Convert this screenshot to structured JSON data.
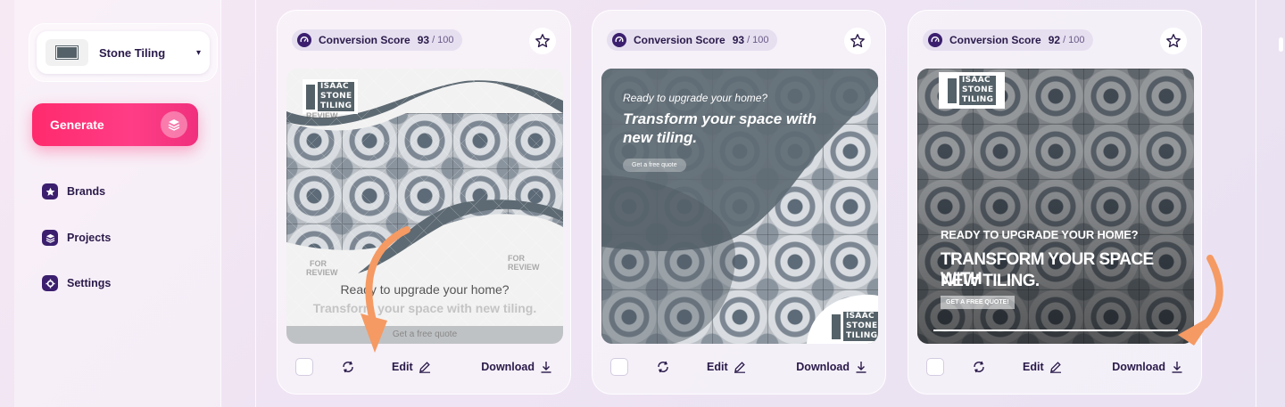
{
  "sidebar": {
    "brand_selector": {
      "name": "Stone Tiling",
      "caret": "▾"
    },
    "generate_label": "Generate",
    "nav": [
      {
        "label": "Brands",
        "icon": "star-icon"
      },
      {
        "label": "Projects",
        "icon": "layers-icon"
      },
      {
        "label": "Settings",
        "icon": "gear-icon"
      }
    ]
  },
  "cards": [
    {
      "score_label": "Conversion Score",
      "score": "93",
      "score_sep": "/",
      "score_max": "100",
      "ad": {
        "style": "watermarked",
        "logo_top": "ISAAC",
        "logo_mid": "STONE",
        "logo_bot": "TILING",
        "watermark_text": "REVIEW",
        "watermark_text_2": "FOR",
        "headline": "Ready to upgrade your home?",
        "subhead": "Transform your space with new tiling.",
        "cta": "Get a free quote"
      },
      "edit_label": "Edit",
      "download_label": "Download"
    },
    {
      "score_label": "Conversion Score",
      "score": "93",
      "score_sep": "/",
      "score_max": "100",
      "ad": {
        "style": "dark-blob",
        "logo_top": "ISAAC",
        "logo_mid": "STONE",
        "logo_bot": "TILING",
        "headline": "Ready to upgrade your home?",
        "subhead": "Transform your space with new tiling.",
        "cta": "Get a free quote"
      },
      "edit_label": "Edit",
      "download_label": "Download"
    },
    {
      "score_label": "Conversion Score",
      "score": "92",
      "score_sep": "/",
      "score_max": "100",
      "ad": {
        "style": "dark-overlay",
        "logo_top": "ISAAC",
        "logo_mid": "STONE",
        "logo_bot": "TILING",
        "headline": "READY TO UPGRADE YOUR HOME?",
        "subhead_1": "TRANSFORM YOUR SPACE WITH",
        "subhead_2": "NEW TILING.",
        "cta": "GET A FREE QUOTE!"
      },
      "edit_label": "Edit",
      "download_label": "Download"
    }
  ],
  "colors": {
    "accent": "#ff2a6d",
    "primary_dark": "#3b1f6e",
    "annotation_arrow": "#f59a63",
    "ad_slate": "#546168"
  }
}
